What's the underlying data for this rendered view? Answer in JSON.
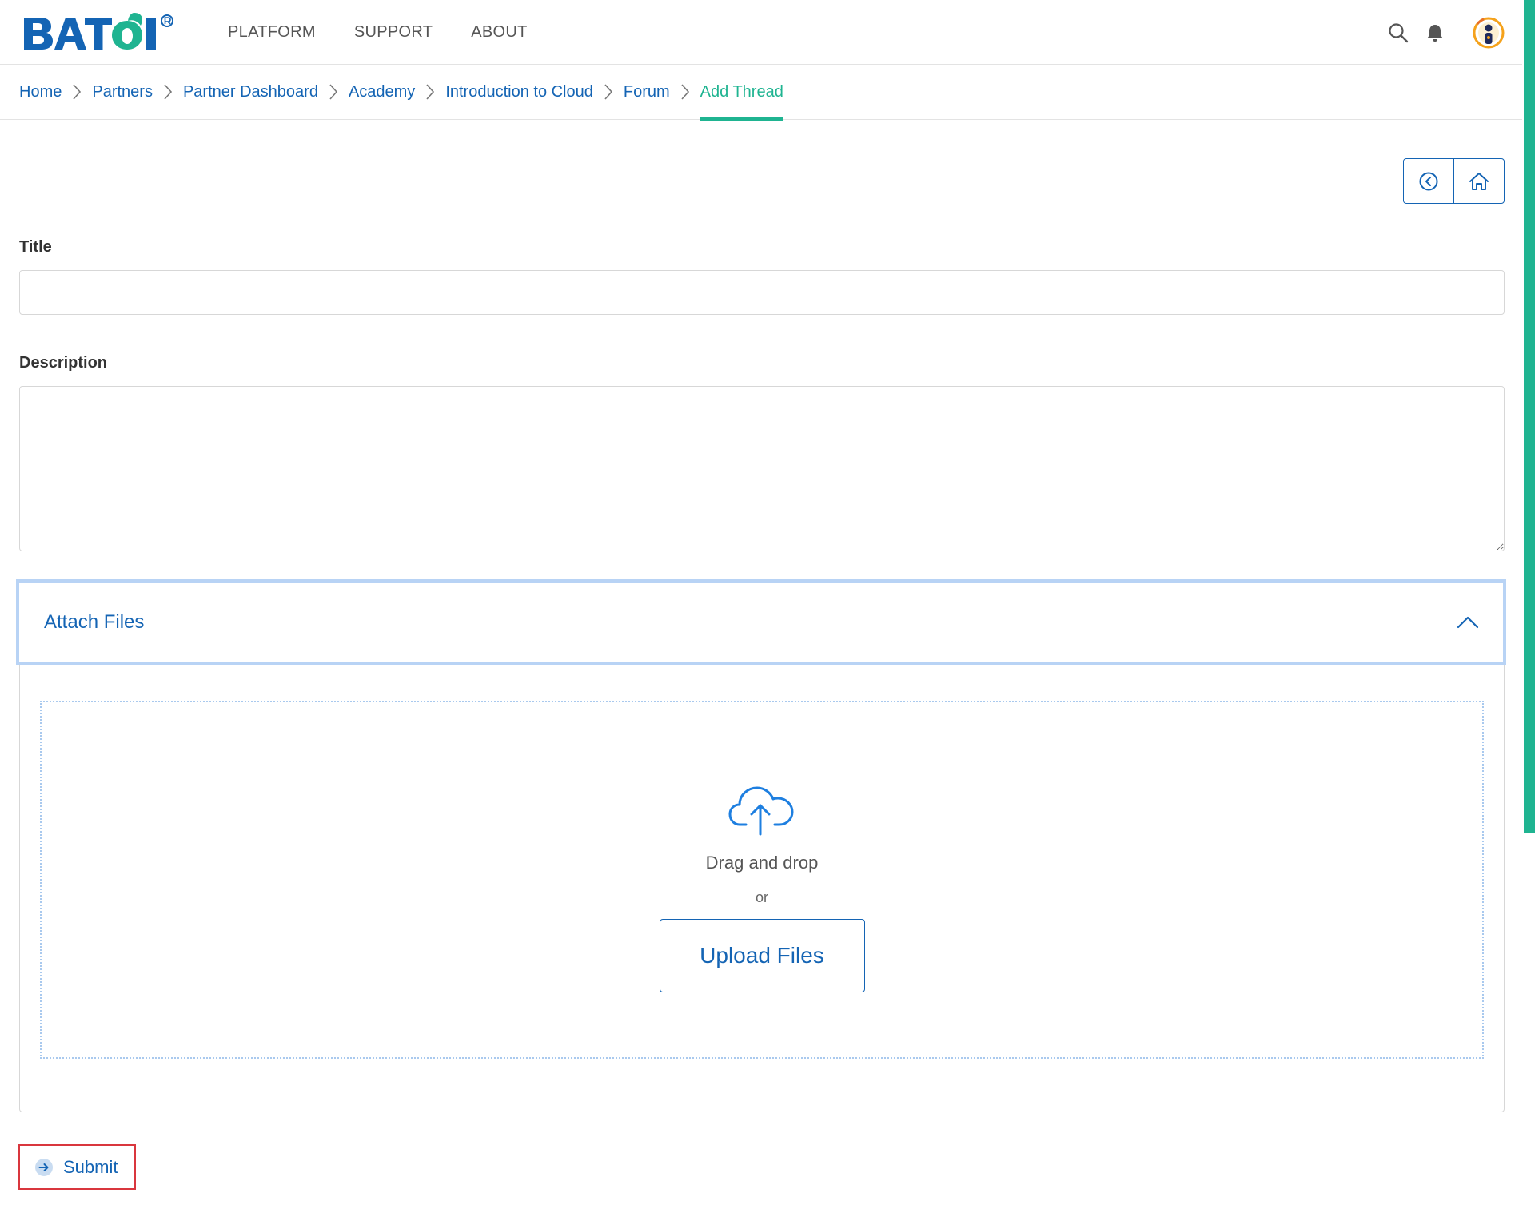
{
  "brand": {
    "logo_text": "BATOI",
    "colors": {
      "primary_blue": "#1464b4",
      "accent_green": "#1fb491",
      "focus_border": "#b8d3f5",
      "submit_outline": "#d9363e"
    }
  },
  "nav": {
    "items": [
      {
        "label": "PLATFORM"
      },
      {
        "label": "SUPPORT"
      },
      {
        "label": "ABOUT"
      }
    ],
    "icons": [
      "search-icon",
      "bell-icon",
      "avatar"
    ]
  },
  "breadcrumb": {
    "items": [
      {
        "label": "Home"
      },
      {
        "label": "Partners"
      },
      {
        "label": "Partner Dashboard"
      },
      {
        "label": "Academy"
      },
      {
        "label": "Introduction to Cloud"
      },
      {
        "label": "Forum"
      },
      {
        "label": "Add Thread"
      }
    ],
    "active_index": 6
  },
  "actions": {
    "back_icon": "circle-chevron-left-icon",
    "home_icon": "home-icon"
  },
  "form": {
    "title_label": "Title",
    "title_value": "",
    "title_placeholder": "",
    "description_label": "Description",
    "description_value": "",
    "description_placeholder": ""
  },
  "attach": {
    "header": "Attach Files",
    "expanded": true,
    "drag_text": "Drag and drop",
    "or_text": "or",
    "upload_label": "Upload Files",
    "upload_icon": "cloud-upload-icon"
  },
  "submit": {
    "label": "Submit",
    "icon": "arrow-right-circle-icon"
  }
}
